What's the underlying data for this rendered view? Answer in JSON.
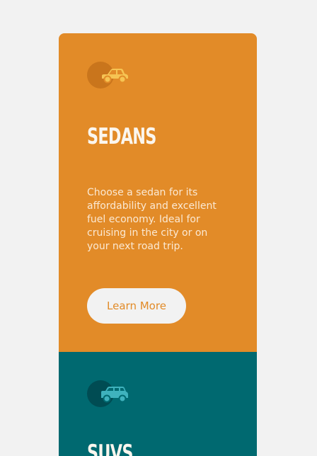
{
  "cards": [
    {
      "icon": "sedan-car-icon",
      "title": "Sedans",
      "text": "Choose a sedan for its affordability and excellent fuel economy. Ideal for cruising in the city or on your next road trip.",
      "button_label": "Learn More",
      "bg_color": "#e28b28",
      "icon_color": "#f6c453"
    },
    {
      "icon": "suv-car-icon",
      "title": "SUVs",
      "bg_color": "#006970",
      "icon_color": "#3fb2bd"
    }
  ],
  "page_bg": "#f2f2f2"
}
